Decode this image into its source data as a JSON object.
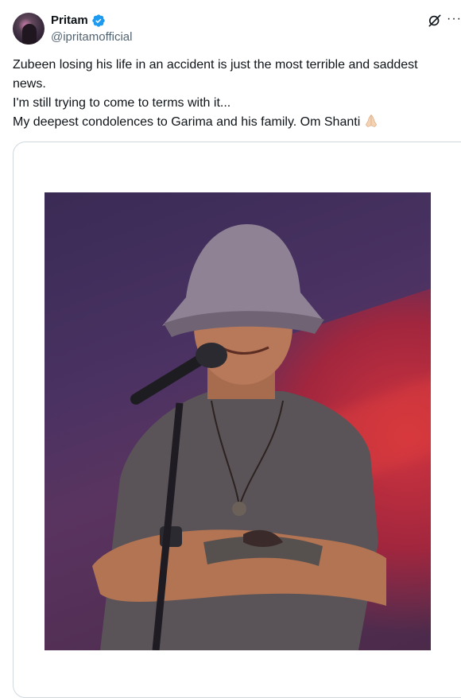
{
  "author": {
    "display_name": "Pritam",
    "handle": "@ipritamofficial",
    "verified": true
  },
  "icons": {
    "verified": "verified-badge-icon",
    "grok": "grok-icon",
    "more": "more-options-icon",
    "emoji": "folded-hands-emoji"
  },
  "colors": {
    "verified_blue": "#1d9bf0",
    "text": "#0f1419",
    "secondary_text": "#536471",
    "card_border": "#cfd9de"
  },
  "tweet": {
    "lines": [
      "Zubeen losing his life in an accident is just the most terrible and saddest",
      "news.",
      "I'm still trying to come to terms with it...",
      "My deepest condolences to Garima and his family. Om Shanti"
    ]
  },
  "more_glyph": "···"
}
